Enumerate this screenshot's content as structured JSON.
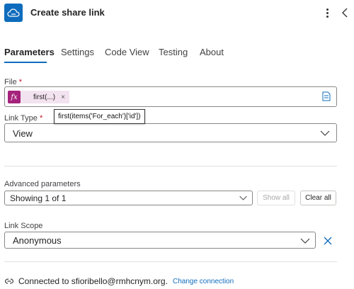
{
  "header": {
    "title": "Create share link",
    "app_icon": "cloud-link-icon",
    "more_icon": "more-vertical-icon",
    "collapse_icon": "chevron-left-icon",
    "accent": "#0f6cbd"
  },
  "tabs": [
    {
      "label": "Parameters",
      "active": true
    },
    {
      "label": "Settings",
      "active": false
    },
    {
      "label": "Code View",
      "active": false
    },
    {
      "label": "Testing",
      "active": false
    },
    {
      "label": "About",
      "active": false
    }
  ],
  "file": {
    "label": "File",
    "required_mark": "*",
    "token_icon": "fx",
    "token_text": "first(...)",
    "token_remove": "×",
    "tooltip": "first(items('For_each')['id'])",
    "token_color": "#a5237c"
  },
  "link_type": {
    "label": "Link Type",
    "required_mark": "*",
    "value": "View"
  },
  "advanced": {
    "label": "Advanced parameters",
    "value": "Showing 1 of 1",
    "show_all": "Show all",
    "clear_all": "Clear all"
  },
  "link_scope": {
    "label": "Link Scope",
    "value": "Anonymous"
  },
  "footer": {
    "connected_text": "Connected to sfioribello@rmhcnym.org.",
    "change_link": "Change connection"
  }
}
